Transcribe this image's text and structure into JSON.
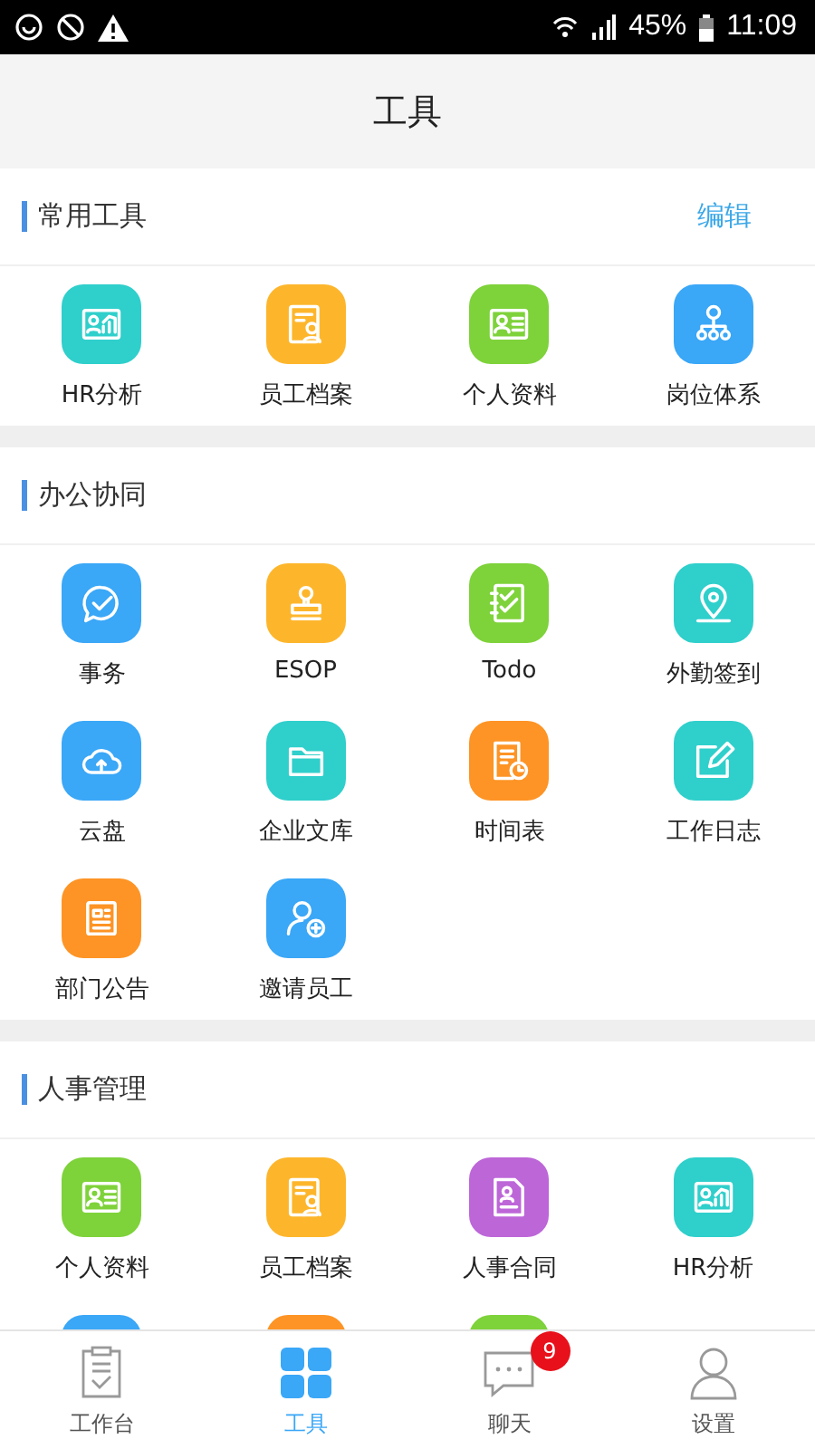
{
  "status_bar": {
    "battery": "45%",
    "time": "11:09"
  },
  "header": {
    "title": "工具"
  },
  "sections": [
    {
      "title": "常用工具",
      "action": "编辑",
      "items": [
        {
          "label": "HR分析",
          "kind": "chart",
          "color": "#2fcfcb"
        },
        {
          "label": "员工档案",
          "kind": "filePerson",
          "color": "#fdb62c"
        },
        {
          "label": "个人资料",
          "kind": "card",
          "color": "#7ed23a"
        },
        {
          "label": "岗位体系",
          "kind": "tree",
          "color": "#3aa7f7"
        }
      ]
    },
    {
      "title": "办公协同",
      "items": [
        {
          "label": "事务",
          "kind": "chatCheck",
          "color": "#3aa7f7"
        },
        {
          "label": "ESOP",
          "kind": "stamp",
          "color": "#fdb62c"
        },
        {
          "label": "Todo",
          "kind": "checklist",
          "color": "#7ed23a"
        },
        {
          "label": "外勤签到",
          "kind": "pin",
          "color": "#2fcfcb"
        },
        {
          "label": "云盘",
          "kind": "cloud",
          "color": "#3aa7f7"
        },
        {
          "label": "企业文库",
          "kind": "folder",
          "color": "#2fcfcb"
        },
        {
          "label": "时间表",
          "kind": "docClock",
          "color": "#fd9425"
        },
        {
          "label": "工作日志",
          "kind": "edit",
          "color": "#2fcfcb"
        },
        {
          "label": "部门公告",
          "kind": "notice",
          "color": "#fd9425"
        },
        {
          "label": "邀请员工",
          "kind": "personAdd",
          "color": "#3aa7f7"
        }
      ]
    },
    {
      "title": "人事管理",
      "items": [
        {
          "label": "个人资料",
          "kind": "card",
          "color": "#7ed23a"
        },
        {
          "label": "员工档案",
          "kind": "filePerson",
          "color": "#fdb62c"
        },
        {
          "label": "人事合同",
          "kind": "contract",
          "color": "#bd66d8"
        },
        {
          "label": "HR分析",
          "kind": "chart",
          "color": "#2fcfcb"
        },
        {
          "color": "#3aa7f7"
        },
        {
          "color": "#fd9425"
        },
        {
          "color": "#7ed23a"
        }
      ]
    }
  ],
  "tabs": [
    {
      "label": "工作台",
      "kind": "clipboard",
      "selected": false
    },
    {
      "label": "工具",
      "kind": "grid",
      "selected": true
    },
    {
      "label": "聊天",
      "kind": "chat",
      "selected": false,
      "badge": "9"
    },
    {
      "label": "设置",
      "kind": "person",
      "selected": false
    }
  ]
}
